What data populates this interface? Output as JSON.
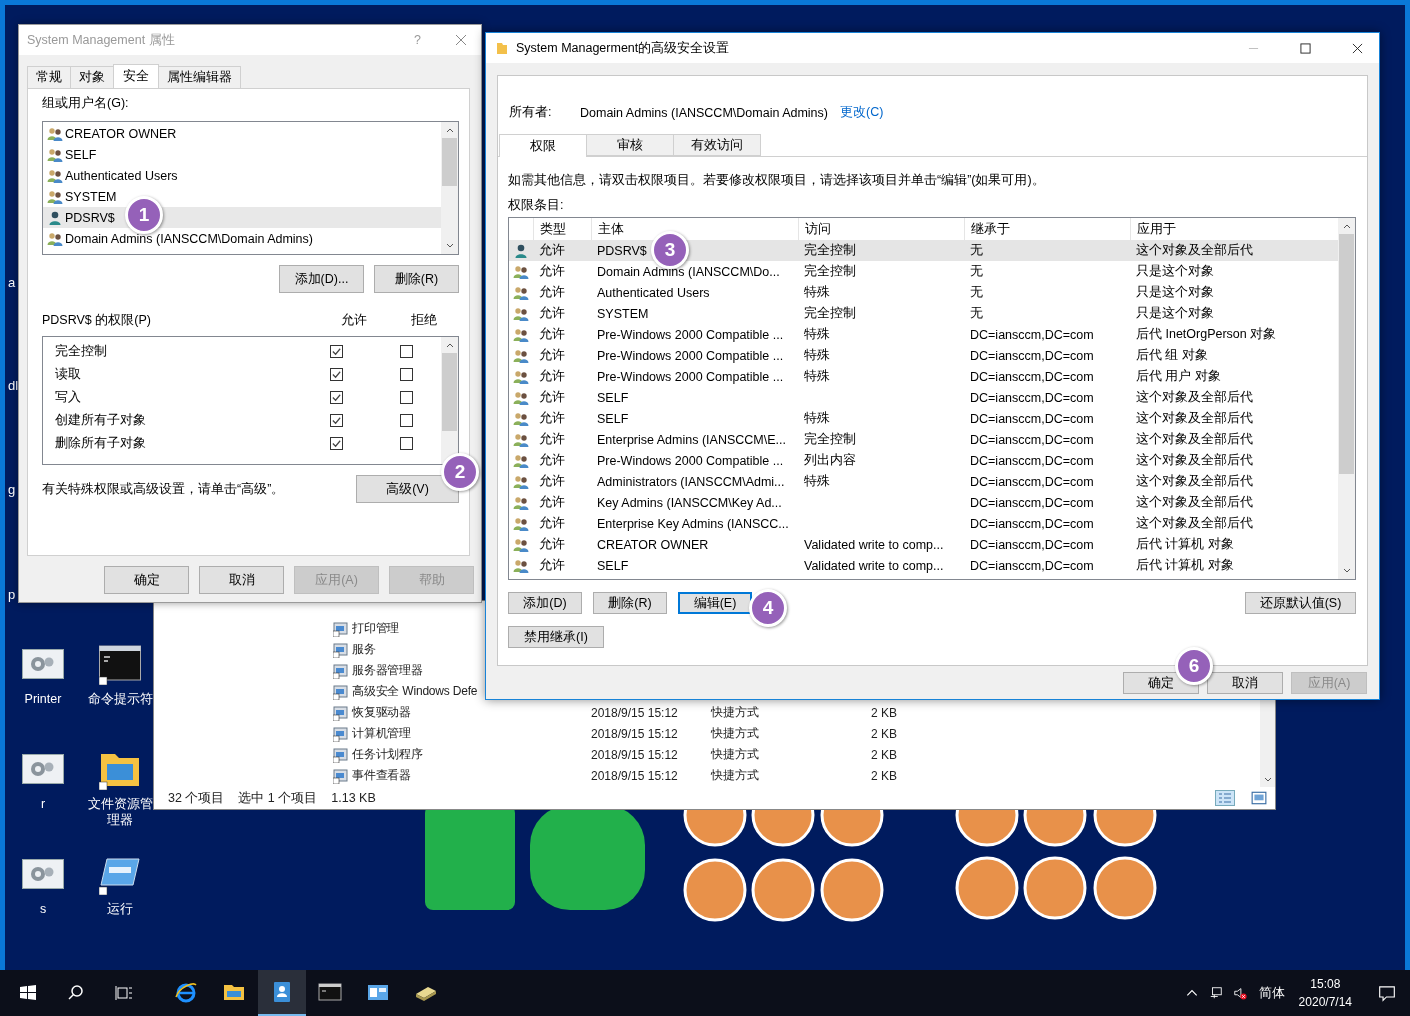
{
  "desktop": {
    "side_labels": [
      "a",
      "dl",
      "g",
      "p"
    ],
    "icons": [
      {
        "label": "Printer",
        "kind": "gear"
      },
      {
        "label": "命令提示符",
        "kind": "console"
      },
      {
        "label": "r",
        "kind": "gear"
      },
      {
        "label": "文件资源管理器",
        "kind": "folder"
      },
      {
        "label": "s",
        "kind": "gear"
      },
      {
        "label": "运行",
        "kind": "run"
      }
    ]
  },
  "explorer": {
    "rows": [
      {
        "name": "打印管理"
      },
      {
        "name": "服务"
      },
      {
        "name": "服务器管理器"
      },
      {
        "name": "高级安全 Windows Defe"
      },
      {
        "name": "恢复驱动器",
        "date": "2018/9/15 15:12",
        "type": "快捷方式",
        "size": "2 KB"
      },
      {
        "name": "计算机管理",
        "date": "2018/9/15 15:12",
        "type": "快捷方式",
        "size": "2 KB"
      },
      {
        "name": "任务计划程序",
        "date": "2018/9/15 15:12",
        "type": "快捷方式",
        "size": "2 KB"
      },
      {
        "name": "事件查看器",
        "date": "2018/9/15 15:12",
        "type": "快捷方式",
        "size": "2 KB"
      }
    ],
    "status": [
      "32 个项目",
      "选中 1 个项目",
      "1.13 KB"
    ]
  },
  "properties_dialog": {
    "title": "System Management 属性",
    "help": "?",
    "tabs": [
      {
        "label": "常规",
        "selected": false
      },
      {
        "label": "对象",
        "selected": false
      },
      {
        "label": "安全",
        "selected": true
      },
      {
        "label": "属性编辑器",
        "selected": false
      }
    ],
    "group_label": "组或用户名(G):",
    "principals": [
      {
        "name": "CREATOR OWNER",
        "kind": "group",
        "selected": false
      },
      {
        "name": "SELF",
        "kind": "group",
        "selected": false
      },
      {
        "name": "Authenticated Users",
        "kind": "group",
        "selected": false
      },
      {
        "name": "SYSTEM",
        "kind": "group",
        "selected": false
      },
      {
        "name": "PDSRV$",
        "kind": "user",
        "selected": true
      },
      {
        "name": "Domain Admins (IANSCCM\\Domain Admins)",
        "kind": "group",
        "selected": false
      }
    ],
    "list_buttons": [
      "添加(D)...",
      "删除(R)"
    ],
    "permissions_label": "PDSRV$ 的权限(P)",
    "allow_header": "允许",
    "deny_header": "拒绝",
    "permissions": [
      {
        "name": "完全控制",
        "allow": true,
        "deny": false
      },
      {
        "name": "读取",
        "allow": true,
        "deny": false
      },
      {
        "name": "写入",
        "allow": true,
        "deny": false
      },
      {
        "name": "创建所有子对象",
        "allow": true,
        "deny": false
      },
      {
        "name": "删除所有子对象",
        "allow": true,
        "deny": false
      }
    ],
    "advanced_hint": "有关特殊权限或高级设置，请单击“高级”。",
    "advanced_button": "高级(V)",
    "footer_buttons": [
      {
        "label": "确定",
        "disabled": false
      },
      {
        "label": "取消",
        "disabled": false
      },
      {
        "label": "应用(A)",
        "disabled": true
      },
      {
        "label": "帮助",
        "disabled": true
      }
    ]
  },
  "advanced_dialog": {
    "title": "System Managerment的高级安全设置",
    "owner_label": "所有者:",
    "owner": "Domain Admins (IANSCCM\\Domain Admins)",
    "owner_link": "更改(C)",
    "tabs": [
      {
        "label": "权限",
        "selected": true
      },
      {
        "label": "审核",
        "selected": false
      },
      {
        "label": "有效访问",
        "selected": false
      }
    ],
    "info": "如需其他信息，请双击权限项目。若要修改权限项目，请选择该项目并单击“编辑”(如果可用)。",
    "entries_label": "权限条目:",
    "columns": [
      "类型",
      "主体",
      "访问",
      "继承于",
      "应用于"
    ],
    "rows": [
      {
        "kind": "user",
        "type": "允许",
        "principal": "PDSRV$",
        "access": "完全控制",
        "inherited": "无",
        "applies": "这个对象及全部后代",
        "selected": true
      },
      {
        "kind": "group",
        "type": "允许",
        "principal": "Domain Admins (IANSCCM\\Do...",
        "access": "完全控制",
        "inherited": "无",
        "applies": "只是这个对象",
        "selected": false
      },
      {
        "kind": "group",
        "type": "允许",
        "principal": "Authenticated Users",
        "access": "特殊",
        "inherited": "无",
        "applies": "只是这个对象",
        "selected": false
      },
      {
        "kind": "group",
        "type": "允许",
        "principal": "SYSTEM",
        "access": "完全控制",
        "inherited": "无",
        "applies": "只是这个对象",
        "selected": false
      },
      {
        "kind": "group",
        "type": "允许",
        "principal": "Pre-Windows 2000 Compatible ...",
        "access": "特殊",
        "inherited": "DC=iansccm,DC=com",
        "applies": "后代 InetOrgPerson 对象",
        "selected": false
      },
      {
        "kind": "group",
        "type": "允许",
        "principal": "Pre-Windows 2000 Compatible ...",
        "access": "特殊",
        "inherited": "DC=iansccm,DC=com",
        "applies": "后代 组 对象",
        "selected": false
      },
      {
        "kind": "group",
        "type": "允许",
        "principal": "Pre-Windows 2000 Compatible ...",
        "access": "特殊",
        "inherited": "DC=iansccm,DC=com",
        "applies": "后代 用户 对象",
        "selected": false
      },
      {
        "kind": "group",
        "type": "允许",
        "principal": "SELF",
        "inherited": "DC=iansccm,DC=com",
        "applies": "这个对象及全部后代",
        "selected": false
      },
      {
        "kind": "group",
        "type": "允许",
        "principal": "SELF",
        "access": "特殊",
        "inherited": "DC=iansccm,DC=com",
        "applies": "这个对象及全部后代",
        "selected": false
      },
      {
        "kind": "group",
        "type": "允许",
        "principal": "Enterprise Admins (IANSCCM\\E...",
        "access": "完全控制",
        "inherited": "DC=iansccm,DC=com",
        "applies": "这个对象及全部后代",
        "selected": false
      },
      {
        "kind": "group",
        "type": "允许",
        "principal": "Pre-Windows 2000 Compatible ...",
        "access": "列出内容",
        "inherited": "DC=iansccm,DC=com",
        "applies": "这个对象及全部后代",
        "selected": false
      },
      {
        "kind": "group",
        "type": "允许",
        "principal": "Administrators (IANSCCM\\Admi...",
        "access": "特殊",
        "inherited": "DC=iansccm,DC=com",
        "applies": "这个对象及全部后代",
        "selected": false
      },
      {
        "kind": "group",
        "type": "允许",
        "principal": "Key Admins (IANSCCM\\Key Ad...",
        "inherited": "DC=iansccm,DC=com",
        "applies": "这个对象及全部后代",
        "selected": false
      },
      {
        "kind": "group",
        "type": "允许",
        "principal": "Enterprise Key Admins (IANSCC...",
        "inherited": "DC=iansccm,DC=com",
        "applies": "这个对象及全部后代",
        "selected": false
      },
      {
        "kind": "group",
        "type": "允许",
        "principal": "CREATOR OWNER",
        "access": "Validated write to comp...",
        "inherited": "DC=iansccm,DC=com",
        "applies": "后代 计算机 对象",
        "selected": false
      },
      {
        "kind": "group",
        "type": "允许",
        "principal": "SELF",
        "access": "Validated write to comp...",
        "inherited": "DC=iansccm,DC=com",
        "applies": "后代 计算机 对象",
        "selected": false
      }
    ],
    "row_buttons": [
      {
        "label": "添加(D)",
        "focused": false
      },
      {
        "label": "删除(R)",
        "focused": false
      },
      {
        "label": "编辑(E)",
        "focused": true
      }
    ],
    "restore_button": "还原默认值(S)",
    "inherit_button": "禁用继承(I)",
    "footer_buttons": [
      {
        "label": "确定",
        "disabled": false
      },
      {
        "label": "取消",
        "disabled": false
      },
      {
        "label": "应用(A)",
        "disabled": true
      }
    ]
  },
  "callouts": [
    "1",
    "2",
    "3",
    "4",
    "6"
  ],
  "taskbar": {
    "apps": [
      {
        "kind": "browser",
        "active": false
      },
      {
        "kind": "folder",
        "active": false
      },
      {
        "kind": "contacts",
        "active": true
      },
      {
        "kind": "console",
        "active": false
      },
      {
        "kind": "control",
        "active": false
      },
      {
        "kind": "drive",
        "active": false
      }
    ],
    "ime": "简体",
    "time": "15:08",
    "date": "2020/7/14"
  }
}
